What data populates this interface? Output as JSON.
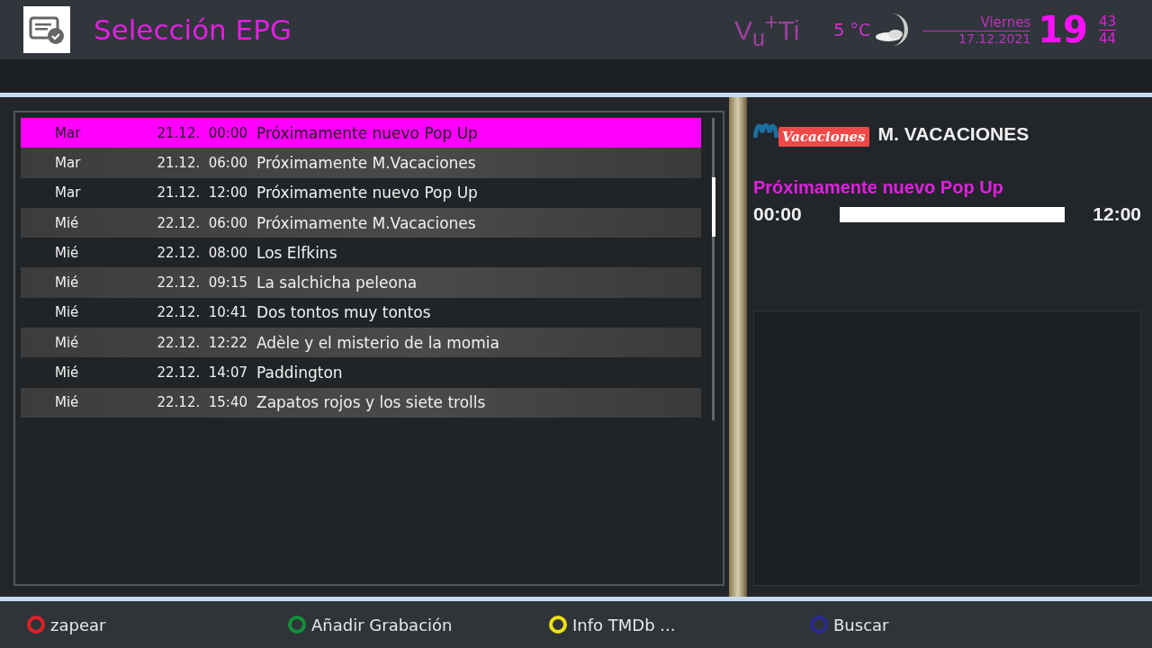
{
  "header": {
    "title": "Selección EPG",
    "brand": "V$_{u}$$^{+}$Ti",
    "temperature": "5 °C",
    "weekday": "Viernes",
    "date": "17.12.2021",
    "hour": "19",
    "minutes": "43",
    "seconds": "44"
  },
  "epg_list": {
    "rows": [
      {
        "day": "Mar",
        "datetime": "21.12.  00:00",
        "title": "Próximamente nuevo Pop Up",
        "selected": true
      },
      {
        "day": "Mar",
        "datetime": "21.12.  06:00",
        "title": "Próximamente M.Vacaciones",
        "selected": false
      },
      {
        "day": "Mar",
        "datetime": "21.12.  12:00",
        "title": "Próximamente nuevo Pop Up",
        "selected": false
      },
      {
        "day": "Mié",
        "datetime": "22.12.  06:00",
        "title": "Próximamente M.Vacaciones",
        "selected": false
      },
      {
        "day": "Mié",
        "datetime": "22.12.  08:00",
        "title": "Los Elfkins",
        "selected": false
      },
      {
        "day": "Mié",
        "datetime": "22.12.  09:15",
        "title": "La salchicha peleona",
        "selected": false
      },
      {
        "day": "Mié",
        "datetime": "22.12.  10:41",
        "title": "Dos tontos muy tontos",
        "selected": false
      },
      {
        "day": "Mié",
        "datetime": "22.12.  12:22",
        "title": "Adèle y el misterio de la momia",
        "selected": false
      },
      {
        "day": "Mié",
        "datetime": "22.12.  14:07",
        "title": "Paddington",
        "selected": false
      },
      {
        "day": "Mié",
        "datetime": "22.12.  15:40",
        "title": "Zapatos rojos y los siete trolls",
        "selected": false
      }
    ]
  },
  "event_info": {
    "channel_logo_text": "Vacaciones",
    "channel_name": "M. VACACIONES",
    "event_title": "Próximamente nuevo Pop Up",
    "start_time": "00:00",
    "end_time": "12:00",
    "level": 1
  },
  "color_keys": [
    {
      "label": "zapear",
      "color": "#e0202a"
    },
    {
      "label": "Añadir Grabación",
      "color": "#10903a"
    },
    {
      "label": "Info TMDb ...",
      "color": "#f0e010"
    },
    {
      "label": "Buscar",
      "color": "#2a2a90"
    }
  ]
}
